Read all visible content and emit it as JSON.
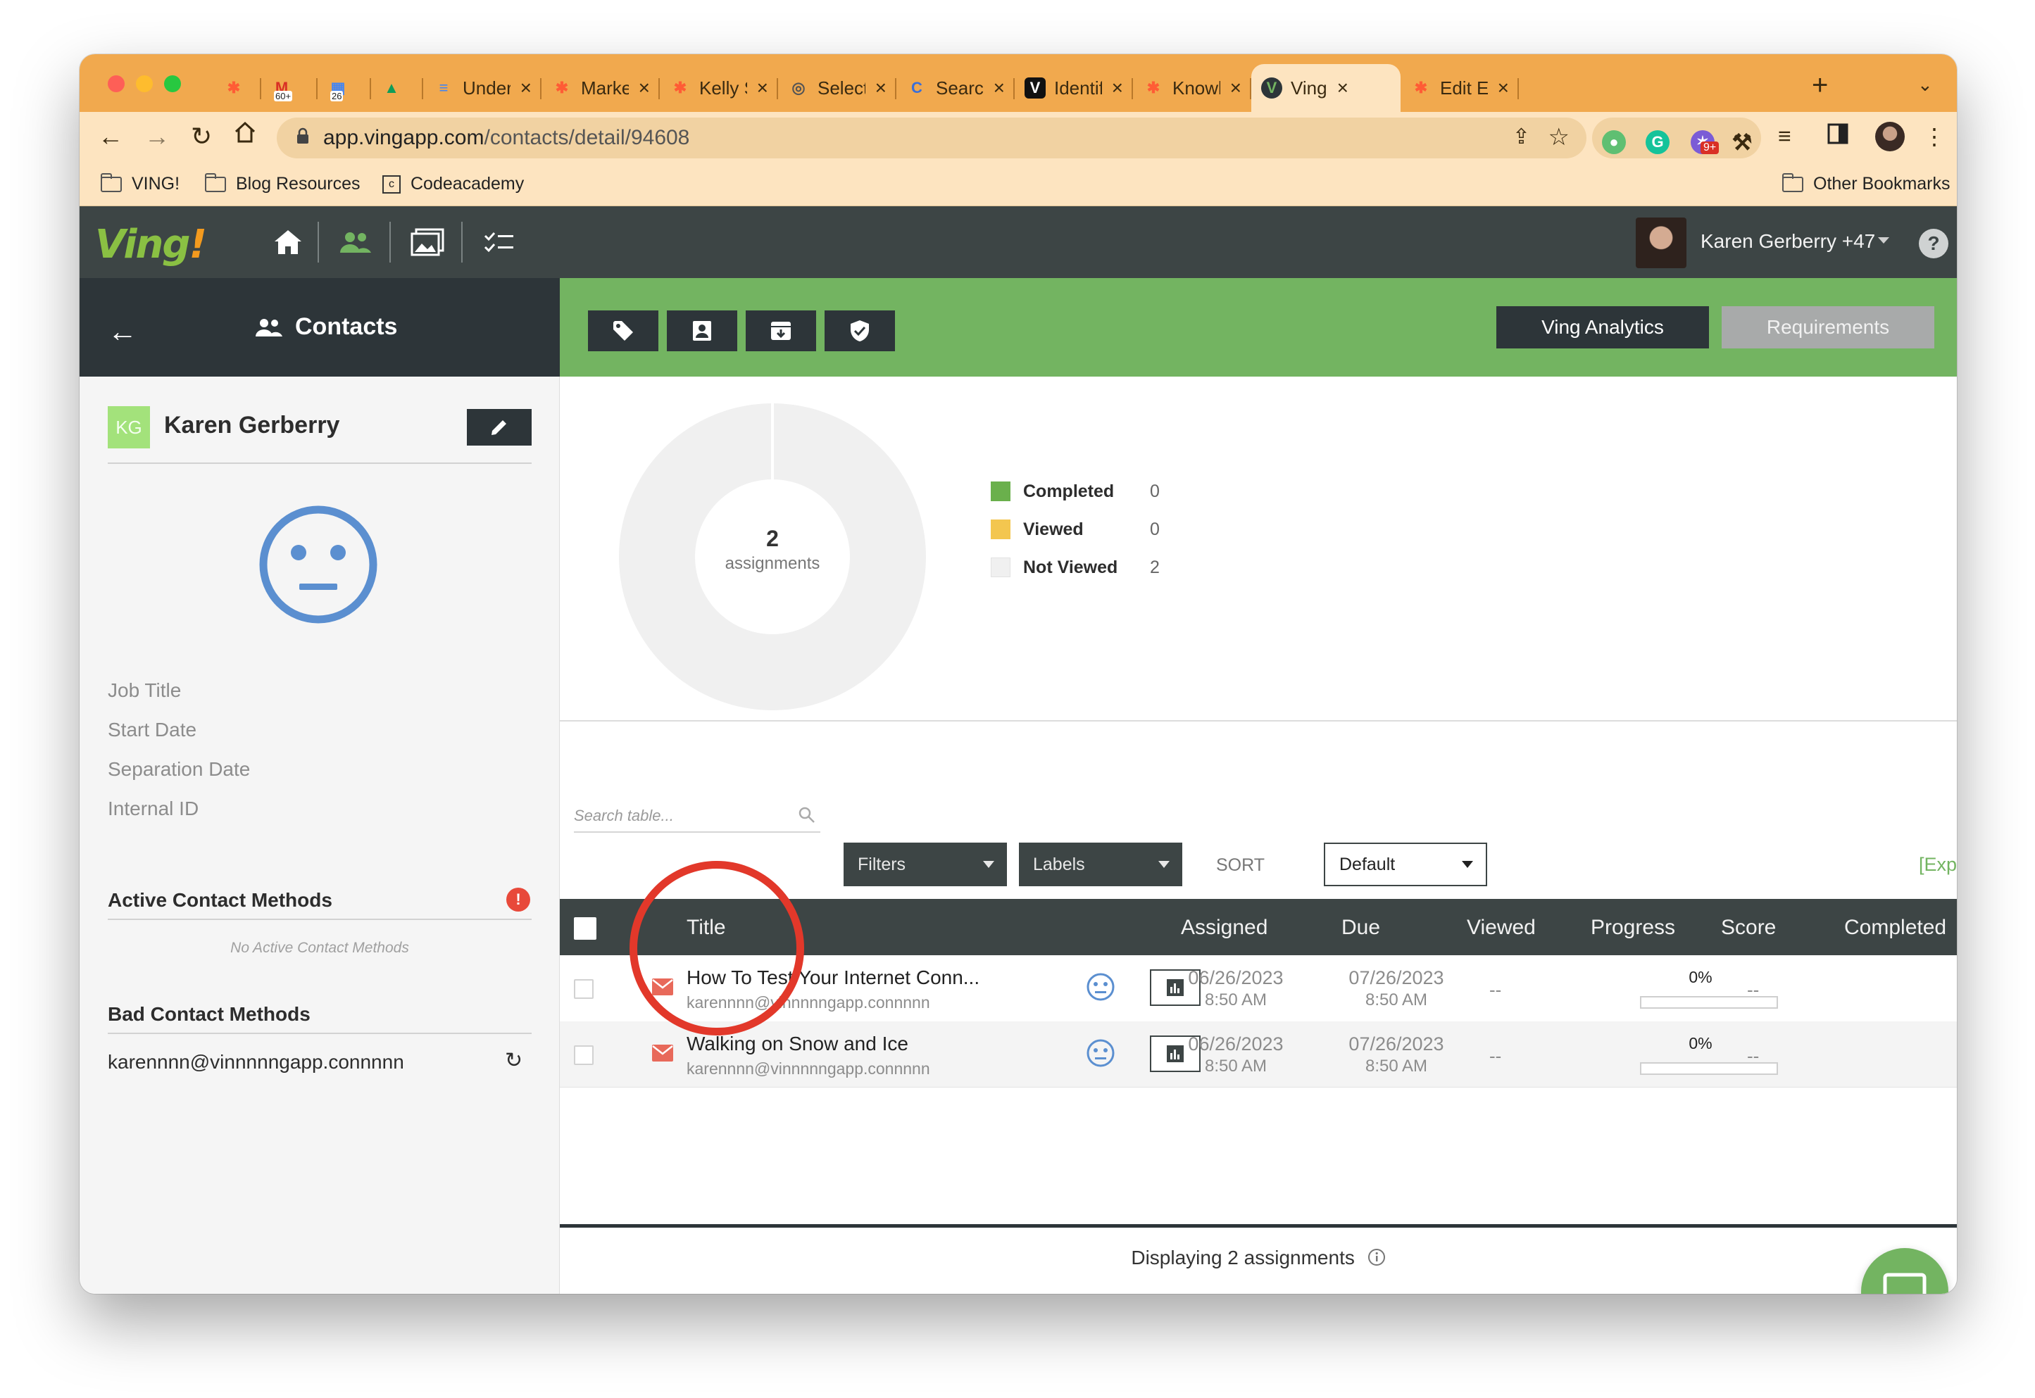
{
  "browser": {
    "tabs": [
      {
        "label": "",
        "icon": "hubspot-icon",
        "color": "#ff5c35"
      },
      {
        "label": "",
        "icon": "gmail-icon",
        "badge": "60+",
        "color": "#d93025"
      },
      {
        "label": "",
        "icon": "calendar-icon",
        "badge": "26",
        "color": "#4285f4"
      },
      {
        "label": "",
        "icon": "drive-icon",
        "color": "#0f9d58"
      },
      {
        "label": "Underst",
        "icon": "docs-icon",
        "color": "#4285f4"
      },
      {
        "label": "Marketi",
        "icon": "hubspot-icon",
        "color": "#ff5c35"
      },
      {
        "label": "Kelly Si",
        "icon": "hubspot-icon",
        "color": "#ff5c35"
      },
      {
        "label": "Select",
        "icon": "globe-icon",
        "color": "#555555"
      },
      {
        "label": "Search",
        "icon": "search-engine-icon",
        "color": "#3b6fd8"
      },
      {
        "label": "Identify",
        "icon": "v-icon",
        "color": "#111111"
      },
      {
        "label": "Knowle",
        "icon": "hubspot-icon",
        "color": "#ff5c35"
      },
      {
        "label": "Ving",
        "icon": "ving-icon",
        "color": "#2d3539",
        "active": true
      },
      {
        "label": "Edit Em",
        "icon": "hubspot-icon",
        "color": "#ff5c35"
      }
    ],
    "url_host": "app.vingapp.com",
    "url_path": "/contacts/detail/94608",
    "ext_badge": "9+",
    "bookmarks": [
      "VING!",
      "Blog Resources",
      "Codeacademy"
    ],
    "other_bookmarks": "Other Bookmarks"
  },
  "app": {
    "user_name": "Karen Gerberry +47",
    "help": "?",
    "section_title": "Contacts",
    "btn_analytics": "Ving Analytics",
    "btn_requirements": "Requirements"
  },
  "contact": {
    "initials": "KG",
    "name": "Karen Gerberry",
    "fields": [
      "Job Title",
      "Start Date",
      "Separation Date",
      "Internal ID"
    ],
    "active_methods_title": "Active Contact Methods",
    "alert": "!",
    "no_active_methods": "No Active Contact Methods",
    "bad_methods_title": "Bad Contact Methods",
    "bad_email": "karennnn@vinnnnngapp.connnnn"
  },
  "chart_data": {
    "type": "pie",
    "center_value": "2",
    "center_label": "assignments",
    "categories": [
      "Completed",
      "Viewed",
      "Not Viewed"
    ],
    "values": [
      0,
      0,
      2
    ],
    "colors": [
      "#6ab04c",
      "#f3c64f",
      "#f0f0f0"
    ]
  },
  "table": {
    "search_placeholder": "Search table...",
    "filters": "Filters",
    "labels": "Labels",
    "sort_label": "SORT",
    "sort_value": "Default",
    "export": "[Expo",
    "columns": [
      "Title",
      "Assigned",
      "Due",
      "Viewed",
      "Progress",
      "Score",
      "Completed"
    ],
    "rows": [
      {
        "title": "How To Test Your Internet Conn...",
        "email": "karennnn@vinnnnngapp.connnnn",
        "assigned_date": "06/26/2023",
        "assigned_time": "8:50 AM",
        "due_date": "07/26/2023",
        "due_time": "8:50 AM",
        "viewed": "--",
        "progress_label": "0%",
        "progress": 0,
        "score": "--"
      },
      {
        "title": "Walking on Snow and Ice",
        "email": "karennnn@vinnnnngapp.connnnn",
        "assigned_date": "06/26/2023",
        "assigned_time": "8:50 AM",
        "due_date": "07/26/2023",
        "due_time": "8:50 AM",
        "viewed": "--",
        "progress_label": "0%",
        "progress": 0,
        "score": "--"
      }
    ],
    "footer": "Displaying 2 assignments"
  },
  "colors": {
    "brand_green": "#73b461",
    "dark": "#2d3539",
    "annotation_red": "#e2382a",
    "tab_orange": "#f1a94e"
  }
}
